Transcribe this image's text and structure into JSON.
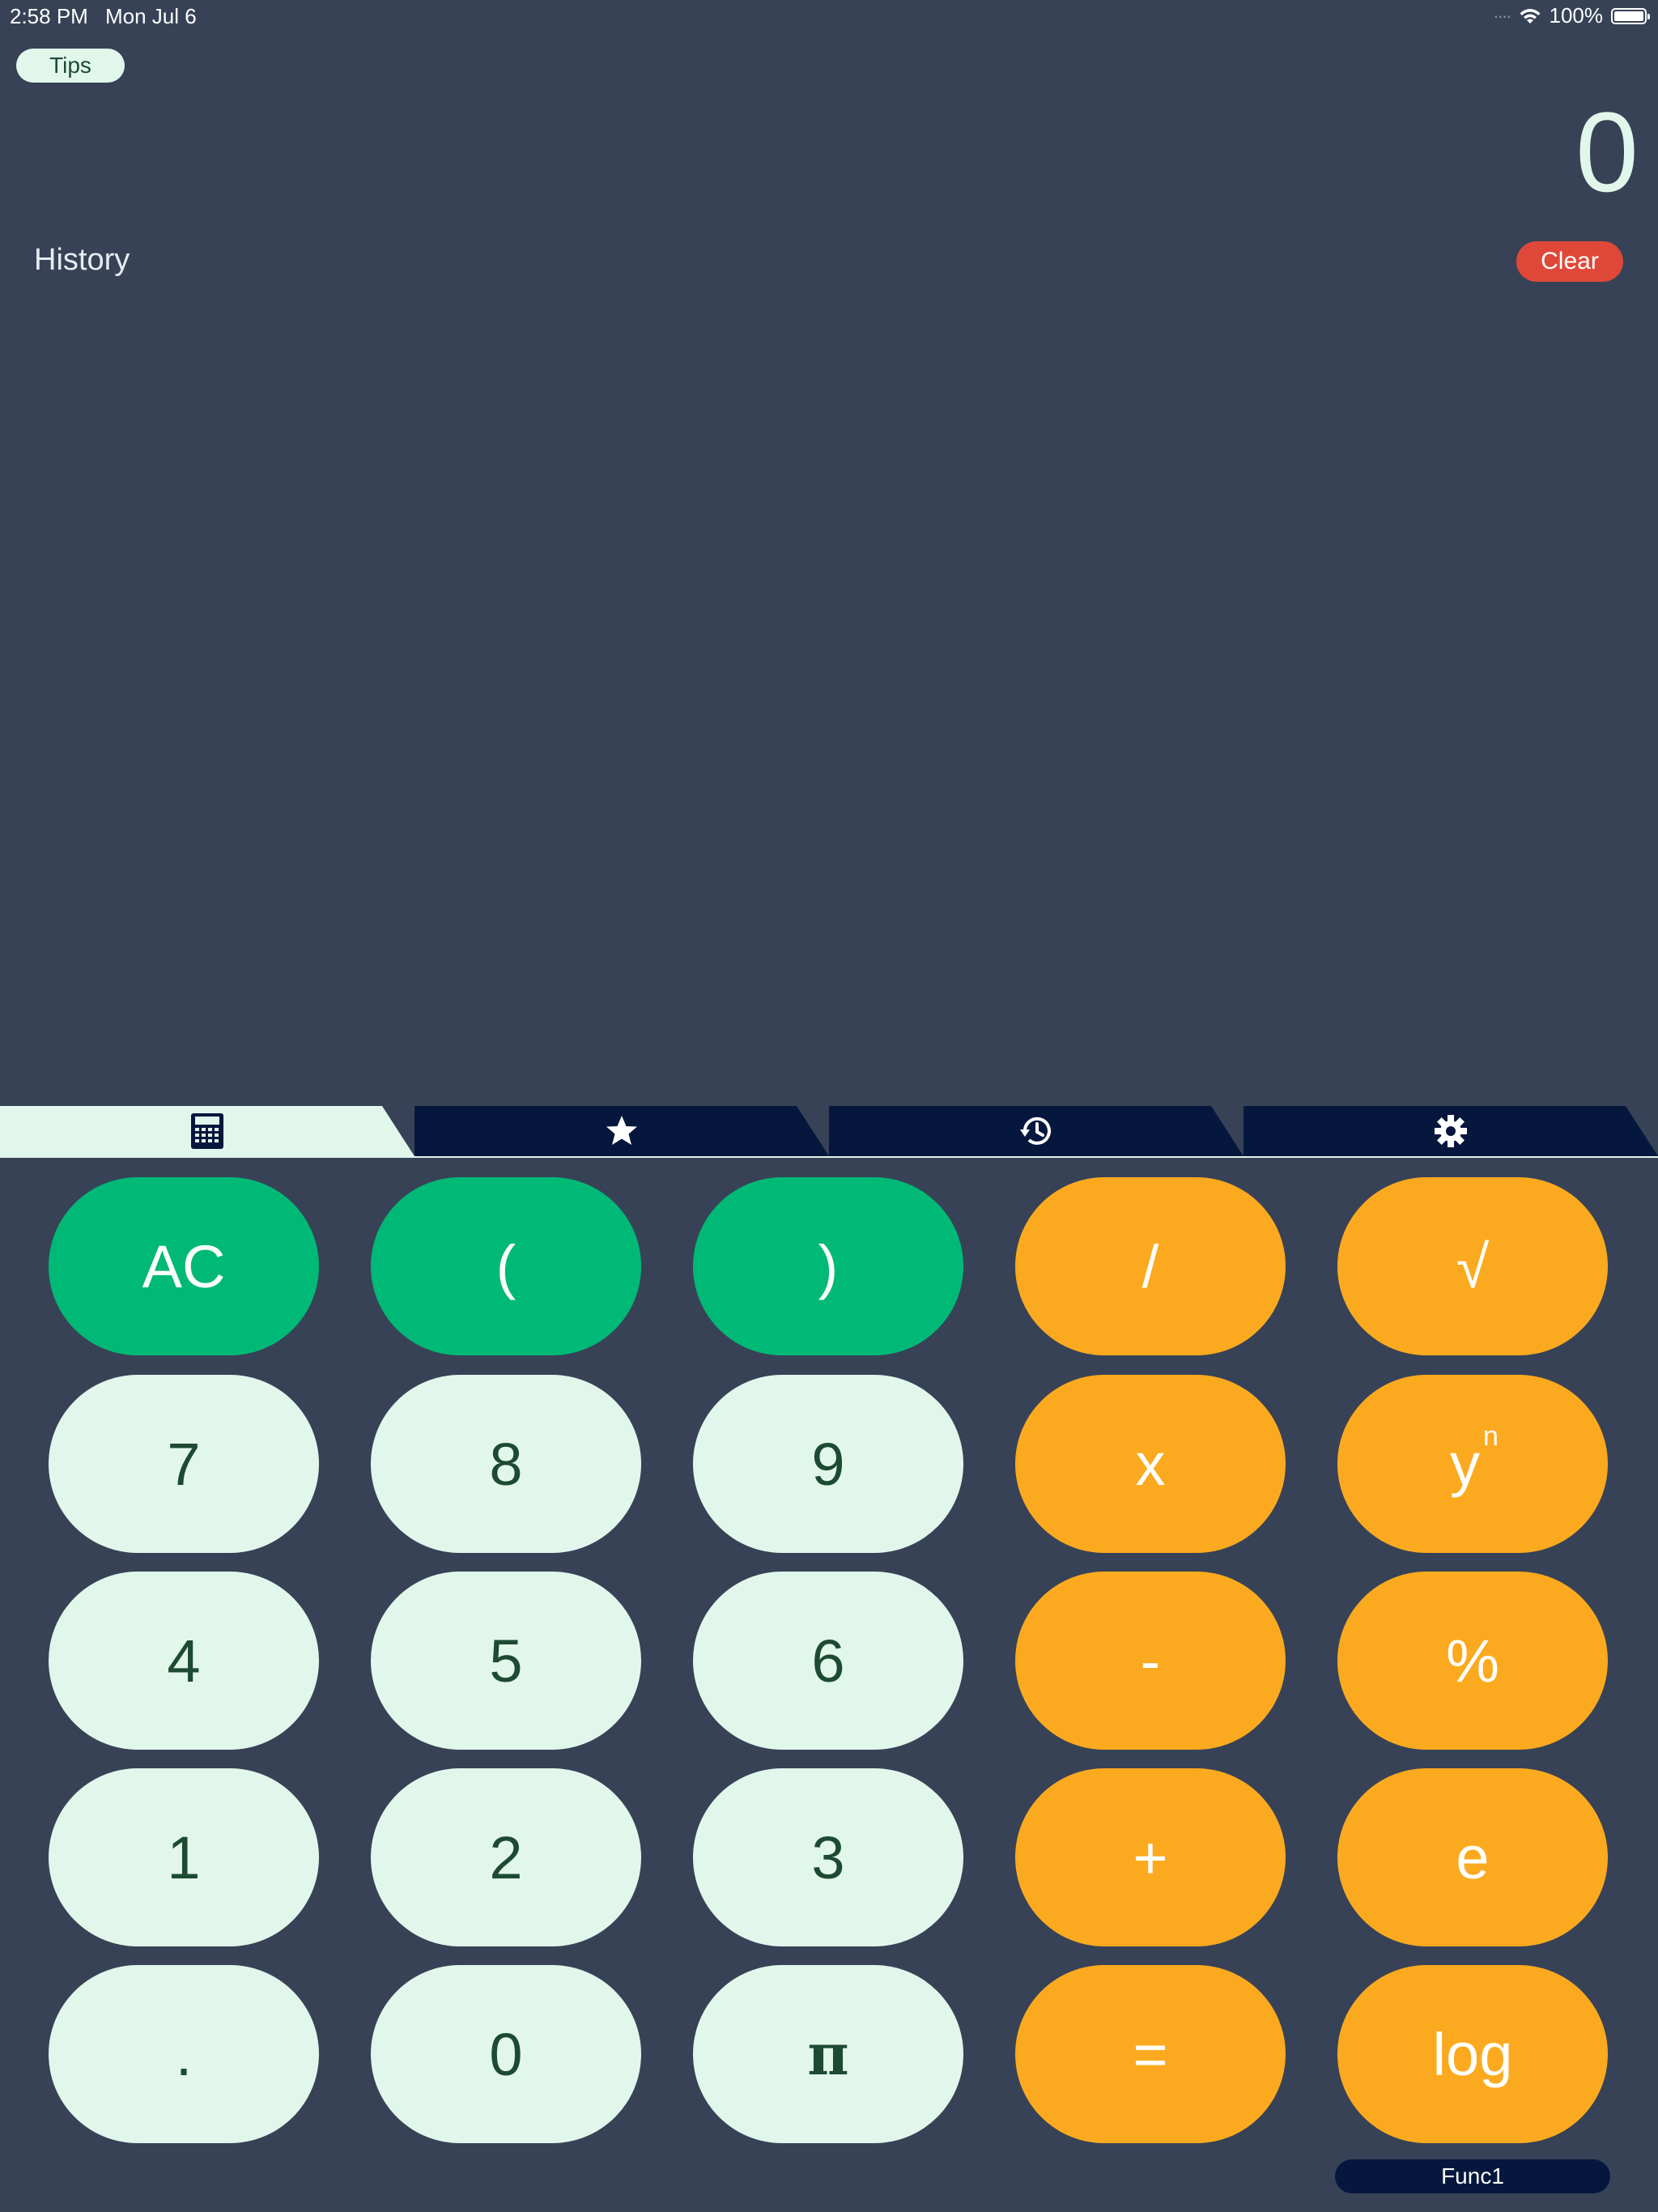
{
  "status_bar": {
    "time": "2:58 PM",
    "date": "Mon Jul 6",
    "battery": "100%"
  },
  "tips_label": "Tips",
  "display_value": "0",
  "history": {
    "title": "History",
    "clear_label": "Clear",
    "items": []
  },
  "tabs": [
    {
      "icon": "calculator-icon",
      "active": true
    },
    {
      "icon": "star-icon",
      "active": false
    },
    {
      "icon": "history-icon",
      "active": false
    },
    {
      "icon": "gear-icon",
      "active": false
    }
  ],
  "keys": {
    "ac": "AC",
    "open_paren": "(",
    "close_paren": ")",
    "divide": "/",
    "sqrt": "√",
    "seven": "7",
    "eight": "8",
    "nine": "9",
    "multiply": "x",
    "power_base": "y",
    "power_exp": "n",
    "four": "4",
    "five": "5",
    "six": "6",
    "minus": "-",
    "percent": "%",
    "one": "1",
    "two": "2",
    "three": "3",
    "plus": "+",
    "e": "e",
    "dot": ".",
    "zero": "0",
    "pi": "π",
    "equals": "=",
    "log": "log"
  },
  "func_label": "Func1",
  "colors": {
    "background": "#374256",
    "green_key": "#00b977",
    "light_key": "#e2f7ec",
    "orange_key": "#fbaa1f",
    "clear": "#df4838",
    "tab_inactive": "#05173d"
  }
}
